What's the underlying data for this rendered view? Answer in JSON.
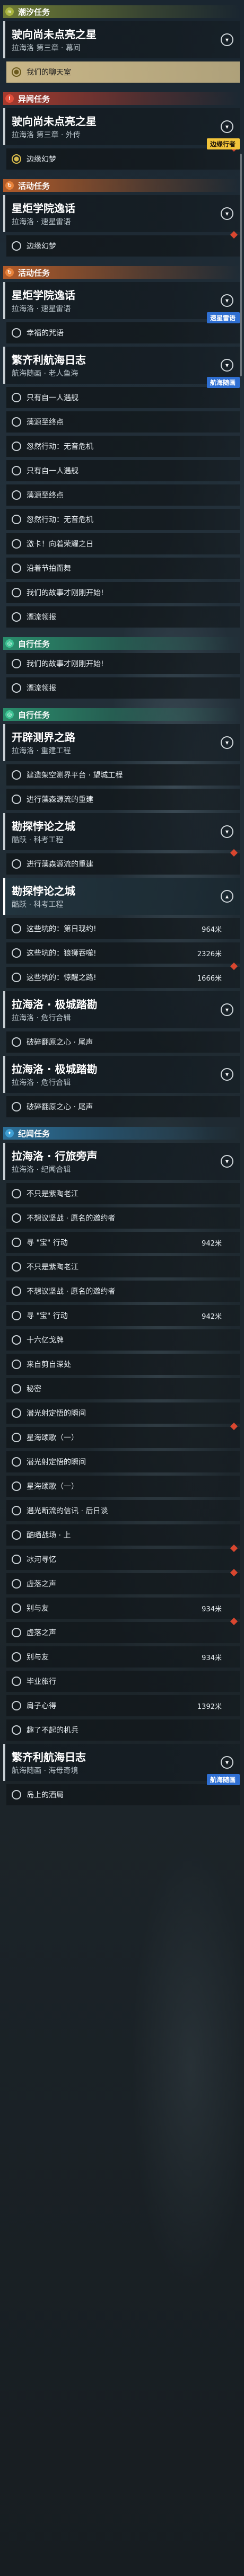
{
  "quest_list": {
    "sections": [
      {
        "category": "潮汐任务",
        "icon": "≈",
        "theme": "daily",
        "quests": [
          {
            "title": "驶向尚未点亮之星",
            "subtitle": "拉海洛 第三章 · 幕间",
            "selected": false,
            "tag": null,
            "tag_color": null,
            "objectives": [
              {
                "text": "我们的聊天室",
                "distance": null,
                "style": "gold",
                "alert": false
              }
            ]
          }
        ]
      },
      {
        "category": "异闻任务",
        "icon": "!",
        "theme": "world",
        "quests": [
          {
            "title": "驶向尚未点亮之星",
            "subtitle": "拉海洛 第三章 · 外传",
            "selected": false,
            "tag": "边缘行者",
            "tag_color": "yellow",
            "objectives": [
              {
                "text": "边缘幻梦",
                "distance": null,
                "style": "done",
                "alert": true
              }
            ]
          }
        ]
      },
      {
        "category": "活动任务",
        "icon": "↻",
        "theme": "event",
        "quests": [
          {
            "title": "星炬学院逸话",
            "subtitle": "拉海洛 · 速星雷语",
            "selected": false,
            "tag": null,
            "tag_color": null,
            "objectives": [
              {
                "text": "边缘幻梦",
                "distance": null,
                "style": "normal",
                "alert": true
              }
            ]
          }
        ]
      },
      {
        "category": "活动任务",
        "icon": "↻",
        "theme": "event",
        "quests": [
          {
            "title": "星炬学院逸话",
            "subtitle": "拉海洛 · 速星雷语",
            "selected": false,
            "tag": "速星雷语",
            "tag_color": "blue",
            "objectives": [
              {
                "text": "幸福的咒语",
                "distance": null,
                "style": "normal",
                "alert": false
              }
            ]
          },
          {
            "title": "繁齐利航海日志",
            "subtitle": "航海随画 · 老人鱼海",
            "selected": false,
            "tag": "航海随画",
            "tag_color": "blue",
            "objectives": [
              {
                "text": "只有自一人遇舰",
                "distance": null,
                "style": "normal",
                "alert": false
              },
              {
                "text": "藻源至终点",
                "distance": null,
                "style": "normal",
                "alert": false
              },
              {
                "text": "忽然行动：无音危机",
                "distance": null,
                "style": "normal",
                "alert": false
              },
              {
                "text": "只有自一人遇舰",
                "distance": null,
                "style": "normal",
                "alert": false
              },
              {
                "text": "藻源至终点",
                "distance": null,
                "style": "normal",
                "alert": false
              },
              {
                "text": "忽然行动：无音危机",
                "distance": null,
                "style": "normal",
                "alert": false
              },
              {
                "text": "激卡！向着荣耀之日",
                "distance": null,
                "style": "normal",
                "alert": false
              },
              {
                "text": "沿着节拍而舞",
                "distance": null,
                "style": "normal",
                "alert": false
              },
              {
                "text": "我们的故事才刚刚开始!",
                "distance": null,
                "style": "normal",
                "alert": false
              },
              {
                "text": "漂流领报",
                "distance": null,
                "style": "normal",
                "alert": false
              }
            ]
          }
        ]
      },
      {
        "category": "自行任务",
        "icon": "◎",
        "theme": "companion",
        "quests": [
          {
            "title": null,
            "subtitle": null,
            "selected": false,
            "tag": null,
            "tag_color": null,
            "objectives": [
              {
                "text": "我们的故事才刚刚开始!",
                "distance": null,
                "style": "normal",
                "alert": false
              },
              {
                "text": "漂流领报",
                "distance": null,
                "style": "normal",
                "alert": false
              }
            ]
          }
        ]
      },
      {
        "category": "自行任务",
        "icon": "◎",
        "theme": "companion",
        "quests": [
          {
            "title": "开辟测界之路",
            "subtitle": "拉海洛 · 重建工程",
            "selected": false,
            "tag": null,
            "tag_color": null,
            "objectives": [
              {
                "text": "建造架空测界平台 · 望城工程",
                "distance": null,
                "style": "normal",
                "alert": false
              },
              {
                "text": "进行藻森源流的重建",
                "distance": null,
                "style": "normal",
                "alert": false
              }
            ]
          },
          {
            "title": "勘探悖论之城",
            "subtitle": "酷跃 · 科考工程",
            "selected": false,
            "tag": null,
            "tag_color": null,
            "objectives": [
              {
                "text": "进行藻森源流的重建",
                "distance": null,
                "style": "normal",
                "alert": true
              }
            ]
          },
          {
            "title": "勘探悖论之城",
            "subtitle": "酷跃 · 科考工程",
            "selected": true,
            "tag": null,
            "tag_color": null,
            "objectives": [
              {
                "text": "这些坑的：第日现约!",
                "distance": "964米",
                "style": "normal",
                "alert": false
              },
              {
                "text": "这些坑的：狼狮吞噬!",
                "distance": "2326米",
                "style": "normal",
                "alert": false
              },
              {
                "text": "这些坑的：惊醒之路!",
                "distance": "1666米",
                "style": "normal",
                "alert": true
              }
            ]
          },
          {
            "title": "拉海洛 · 极城踏勘",
            "subtitle": "拉海洛 · 危行合辑",
            "selected": false,
            "tag": null,
            "tag_color": null,
            "objectives": [
              {
                "text": "破碎翻原之心 · 尾声",
                "distance": null,
                "style": "normal",
                "alert": false
              }
            ]
          },
          {
            "title": "拉海洛 · 极城踏勘",
            "subtitle": "拉海洛 · 危行合辑",
            "selected": false,
            "tag": null,
            "tag_color": null,
            "objectives": [
              {
                "text": "破碎翻原之心 · 尾声",
                "distance": null,
                "style": "normal",
                "alert": false
              }
            ]
          }
        ]
      },
      {
        "category": "纪闻任务",
        "icon": "✦",
        "theme": "chronicle",
        "quests": [
          {
            "title": "拉海洛 · 行旅旁声",
            "subtitle": "拉海洛 · 纪闻合辑",
            "selected": false,
            "tag": null,
            "tag_color": null,
            "objectives": [
              {
                "text": "不只是紫陶老江",
                "distance": null,
                "style": "normal",
                "alert": false
              },
              {
                "text": "不想议坚战 · 愿名的邀约者",
                "distance": null,
                "style": "normal",
                "alert": false
              },
              {
                "text": "寻 \"宝\" 行动",
                "distance": "942米",
                "style": "normal",
                "alert": false
              },
              {
                "text": "不只是紫陶老江",
                "distance": null,
                "style": "normal",
                "alert": false
              },
              {
                "text": "不想议坚战 · 愿名的邀约者",
                "distance": null,
                "style": "normal",
                "alert": false
              },
              {
                "text": "寻 \"宝\" 行动",
                "distance": "942米",
                "style": "normal",
                "alert": false
              },
              {
                "text": "十六亿戈牌",
                "distance": null,
                "style": "normal",
                "alert": false
              },
              {
                "text": "来自剪自深处",
                "distance": null,
                "style": "normal",
                "alert": false
              },
              {
                "text": "秘密",
                "distance": null,
                "style": "normal",
                "alert": false
              },
              {
                "text": "潜光射定悟的瞬间",
                "distance": null,
                "style": "normal",
                "alert": false
              },
              {
                "text": "星海颂歌（一）",
                "distance": null,
                "style": "normal",
                "alert": true
              },
              {
                "text": "潜光射定悟的瞬间",
                "distance": null,
                "style": "normal",
                "alert": false
              },
              {
                "text": "星海颂歌（一）",
                "distance": null,
                "style": "normal",
                "alert": false
              },
              {
                "text": "遇光断流的信讯 · 后日谈",
                "distance": null,
                "style": "normal",
                "alert": false
              },
              {
                "text": "酷晒战场 · 上",
                "distance": null,
                "style": "normal",
                "alert": false
              },
              {
                "text": "冰河寻忆",
                "distance": null,
                "style": "normal",
                "alert": true
              },
              {
                "text": "虚落之声",
                "distance": null,
                "style": "normal",
                "alert": true
              },
              {
                "text": "别与友",
                "distance": "934米",
                "style": "normal",
                "alert": false
              },
              {
                "text": "虚落之声",
                "distance": null,
                "style": "normal",
                "alert": true
              },
              {
                "text": "别与友",
                "distance": "934米",
                "style": "normal",
                "alert": false
              },
              {
                "text": "毕业旅行",
                "distance": null,
                "style": "normal",
                "alert": false
              },
              {
                "text": "肩子心得",
                "distance": "1392米",
                "style": "normal",
                "alert": false
              },
              {
                "text": "趣了不起的机兵",
                "distance": null,
                "style": "normal",
                "alert": false
              }
            ]
          },
          {
            "title": "繁齐利航海日志",
            "subtitle": "航海随画 · 海母奇境",
            "selected": false,
            "tag": "航海随画",
            "tag_color": "blue",
            "objectives": [
              {
                "text": "岛上的酒局",
                "distance": null,
                "style": "normal",
                "alert": false
              }
            ]
          }
        ]
      }
    ]
  }
}
